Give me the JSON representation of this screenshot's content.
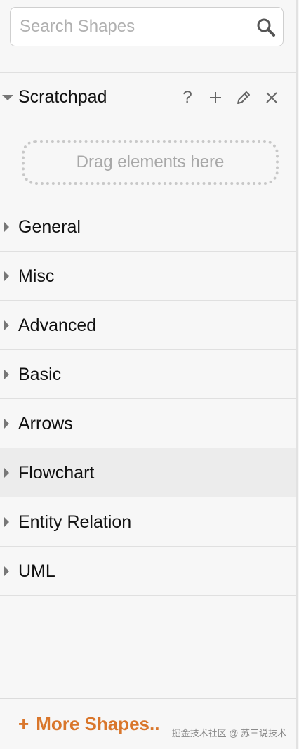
{
  "search": {
    "placeholder": "Search Shapes",
    "value": "",
    "icon": "search-icon"
  },
  "scratchpad": {
    "title": "Scratchpad",
    "expanded": true,
    "tools": [
      {
        "name": "help",
        "glyph": "?"
      },
      {
        "name": "add",
        "glyph": "+"
      },
      {
        "name": "edit",
        "glyph": "pencil-icon"
      },
      {
        "name": "close",
        "glyph": "×"
      }
    ],
    "drop_hint": "Drag elements here"
  },
  "categories": [
    {
      "label": "General",
      "highlighted": false
    },
    {
      "label": "Misc",
      "highlighted": false
    },
    {
      "label": "Advanced",
      "highlighted": false
    },
    {
      "label": "Basic",
      "highlighted": false
    },
    {
      "label": "Arrows",
      "highlighted": false
    },
    {
      "label": "Flowchart",
      "highlighted": true
    },
    {
      "label": "Entity Relation",
      "highlighted": false
    },
    {
      "label": "UML",
      "highlighted": false
    }
  ],
  "footer": {
    "plus": "+",
    "more_shapes_label": "More Shapes..",
    "watermark": "掘金技术社区 @ 苏三说技术"
  },
  "colors": {
    "accent": "#d9762b",
    "highlight_row": "#ececec",
    "panel_bg": "#f7f7f7"
  }
}
